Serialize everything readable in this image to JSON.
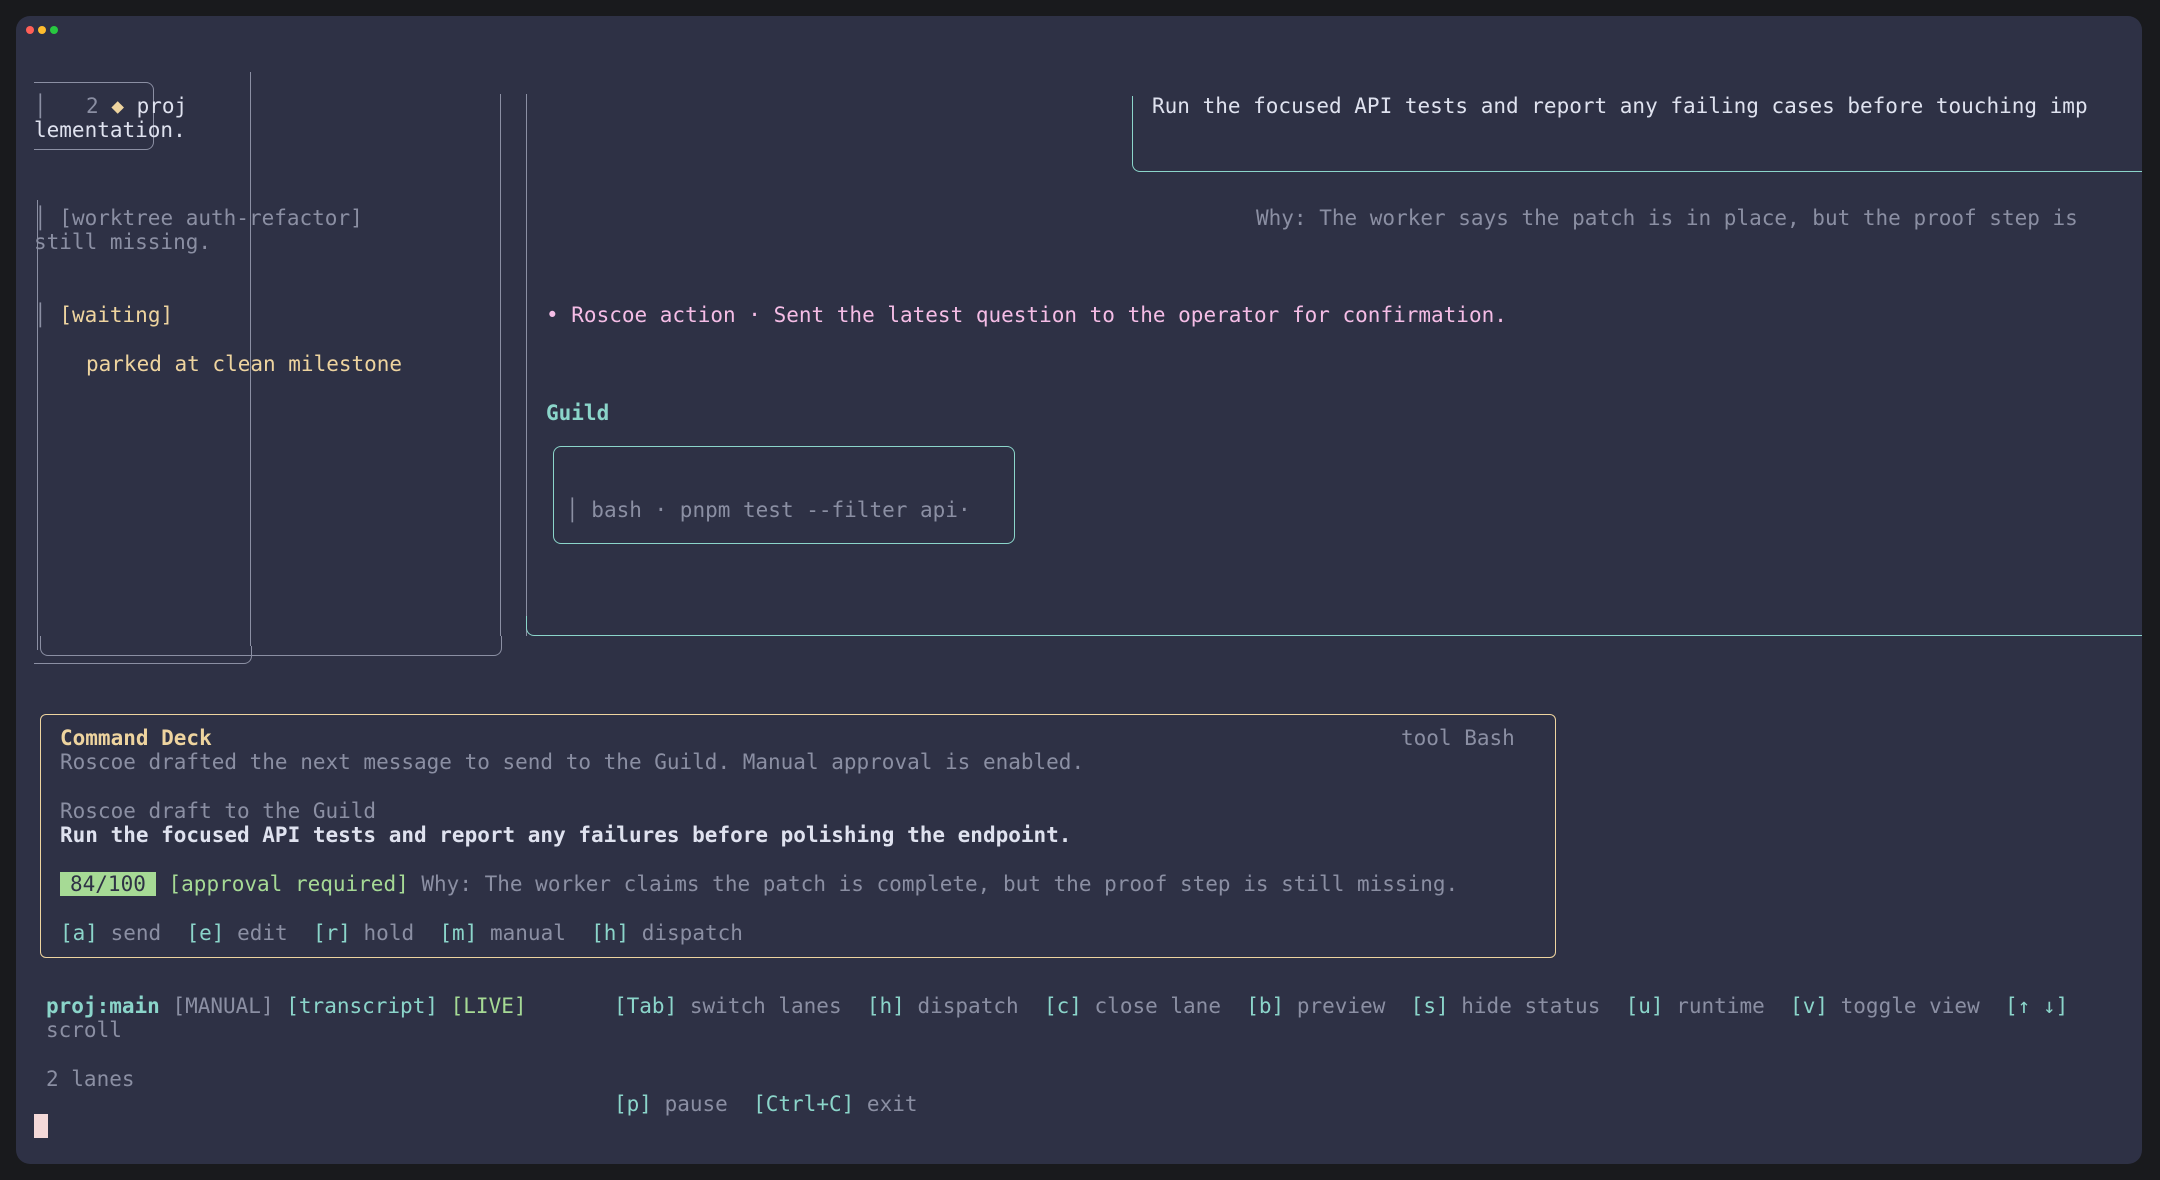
{
  "lanes_panel": {
    "lane_number": "2",
    "lane_marker": "◆",
    "lane_name": "proj",
    "lane_title_cont": "lementation.",
    "worktree": "[worktree auth-refactor]",
    "worktree_cont": "still missing.",
    "status": "[waiting]",
    "status_note": "parked at clean milestone"
  },
  "transcript": {
    "instruction": "Run the focused API tests and report any failing cases before touching imp",
    "why": "Why: The worker says the patch is in place, but the proof step is",
    "action": "• Roscoe action · Sent the latest question to the operator for confirmation.",
    "guild_label": "Guild",
    "tool_call": "bash · pnpm test --filter api·"
  },
  "command_deck": {
    "title": "Command Deck",
    "tool": "tool Bash",
    "summary": "Roscoe drafted the next message to send to the Guild. Manual approval is enabled.",
    "draft_label": "Roscoe draft to the Guild",
    "draft_message": "Run the focused API tests and report any failures before polishing the endpoint.",
    "score": "84/100",
    "approval": "[approval required]",
    "why": "Why: The worker claims the patch is complete, but the proof step is still missing.",
    "actions": [
      {
        "key": "[a]",
        "label": "send"
      },
      {
        "key": "[e]",
        "label": "edit"
      },
      {
        "key": "[r]",
        "label": "hold"
      },
      {
        "key": "[m]",
        "label": "manual"
      },
      {
        "key": "[h]",
        "label": "dispatch"
      }
    ]
  },
  "status_bar": {
    "project": "proj:main",
    "mode": "[MANUAL]",
    "view": "[transcript]",
    "live": "[LIVE]",
    "lanes_count": "2 lanes",
    "shortcuts": [
      {
        "key": "[Tab]",
        "label": "switch lanes"
      },
      {
        "key": "[h]",
        "label": "dispatch"
      },
      {
        "key": "[c]",
        "label": "close lane"
      },
      {
        "key": "[b]",
        "label": "preview"
      },
      {
        "key": "[s]",
        "label": "hide status"
      },
      {
        "key": "[u]",
        "label": "runtime"
      },
      {
        "key": "[v]",
        "label": "toggle view"
      },
      {
        "key": "[↑ ↓]",
        "label": "scroll"
      },
      {
        "key": "[p]",
        "label": "pause"
      },
      {
        "key": "[Ctrl+C]",
        "label": "exit"
      }
    ]
  },
  "colors": {
    "background": "#2e3145",
    "accent_teal": "#8bd5ca",
    "accent_yellow": "#eed49f",
    "accent_pink": "#f5bde6",
    "accent_green": "#a6da95"
  }
}
